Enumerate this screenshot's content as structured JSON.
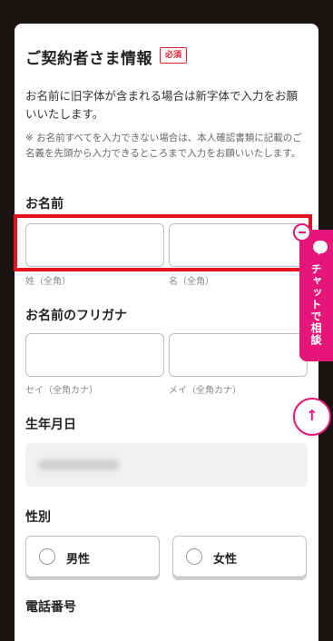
{
  "section": {
    "title": "ご契約者さま情報",
    "required_badge": "必須",
    "description": "お名前に旧字体が含まれる場合は新字体で入力をお願いいたします。",
    "note": "※ お名前すべてを入力できない場合は、本人確認書類に記載のご名義を先頭から入力できるところまで入力をお願いいたします。"
  },
  "name": {
    "label": "お名前",
    "last_hint": "姓（全角）",
    "first_hint": "名（全角）",
    "last_value": "",
    "first_value": ""
  },
  "furigana": {
    "label": "お名前のフリガナ",
    "last_hint": "セイ（全角カナ）",
    "first_hint": "メイ（全角カナ）",
    "last_value": "",
    "first_value": ""
  },
  "birthdate": {
    "label": "生年月日"
  },
  "gender": {
    "label": "性別",
    "options": [
      "男性",
      "女性"
    ]
  },
  "phone": {
    "label": "電話番号"
  },
  "chat": {
    "label": "チャットで相談"
  },
  "scroll_top": {
    "icon": "arrow-up-icon",
    "glyph": "↑"
  },
  "colors": {
    "accent": "#e5157a",
    "required": "#e0202a",
    "highlight": "#e5141c"
  }
}
